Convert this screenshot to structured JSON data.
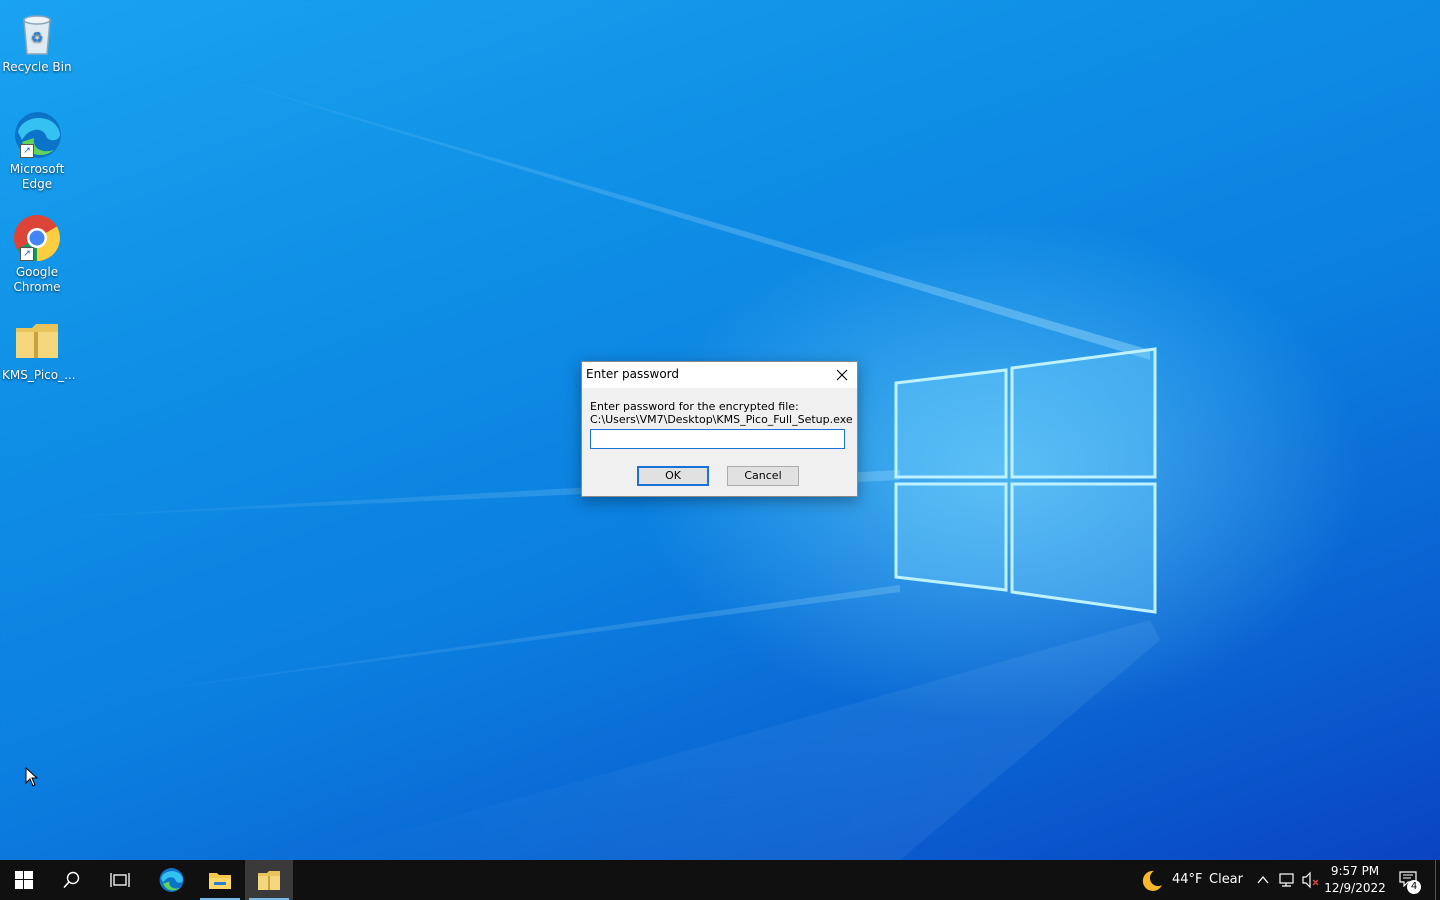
{
  "desktop": {
    "icons": [
      {
        "label": "Recycle Bin"
      },
      {
        "label": "Microsoft Edge"
      },
      {
        "label": "Google Chrome"
      },
      {
        "label": "KMS_Pico_..."
      }
    ]
  },
  "dialog": {
    "title": "Enter password",
    "prompt": "Enter password for the encrypted file:",
    "file_path": "C:\\Users\\VM7\\Desktop\\KMS_Pico_Full_Setup.exe",
    "password_value": "",
    "ok_label": "OK",
    "cancel_label": "Cancel"
  },
  "taskbar": {
    "weather_temp": "44°F",
    "weather_cond": "Clear",
    "time": "9:57 PM",
    "date": "12/9/2022",
    "notification_count": "4",
    "icons": [
      "start-icon",
      "search-icon",
      "task-view-icon",
      "edge-icon",
      "file-explorer-icon",
      "archive-app-icon"
    ]
  },
  "colors": {
    "accent": "#1a74d8",
    "taskbar": "#101010",
    "desktop": "#0b7fe0"
  }
}
